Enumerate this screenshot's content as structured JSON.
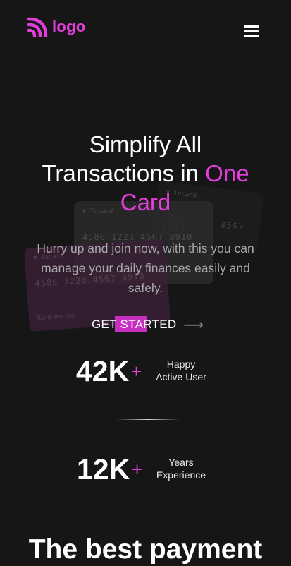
{
  "brand": {
    "logo_text": "logo",
    "accent_color": "#e03ed8",
    "icon": "rss-feed-icon"
  },
  "nav": {
    "menu_icon": "hamburger-menu-icon"
  },
  "hero": {
    "title_line1": "Simplify All",
    "title_line2_prefix": "Transactions in ",
    "title_line2_accent": "One",
    "title_line3_accent": "Card",
    "subtitle": "Hurry up and join now, with this you can manage your daily finances easily and safely.",
    "cta_label": "GET STARTED",
    "cta_arrow": "⟶"
  },
  "cards": [
    {
      "brand": "▼ Tucard",
      "number": "4586  1223  4567  8910",
      "name": ""
    },
    {
      "brand": "▼ Tucard",
      "number": "4586  1223  4567  8910",
      "name": ""
    },
    {
      "brand": "▼ Tucard",
      "number": "4586  1223  4567  8910",
      "name": "King Harjam"
    }
  ],
  "stats": [
    {
      "value": "42K",
      "suffix": "+",
      "label_line1": "Happy",
      "label_line2": "Active User"
    },
    {
      "value": "12K",
      "suffix": "+",
      "label_line1": "Years",
      "label_line2": "Experience"
    }
  ],
  "next_section": {
    "title": "The best payment"
  }
}
